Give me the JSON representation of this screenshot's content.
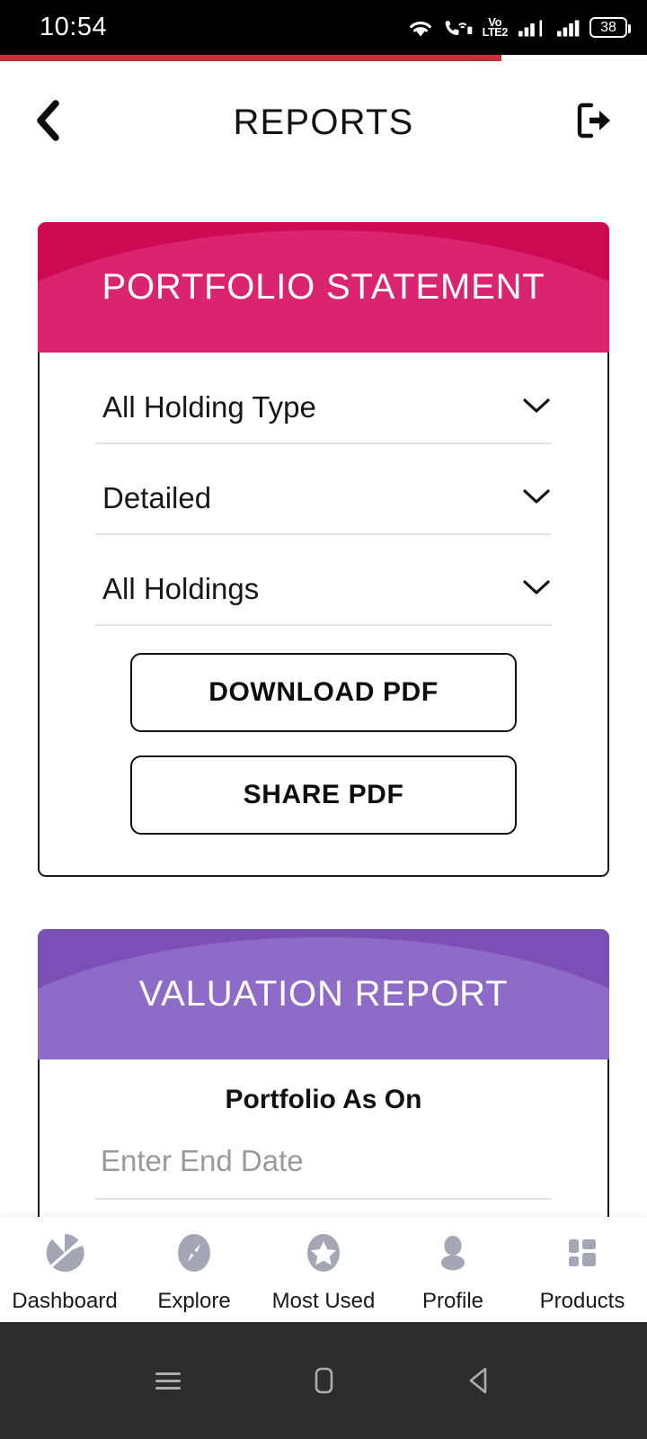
{
  "status_bar": {
    "time": "10:54",
    "battery_level": "38",
    "volte_top": "Vo",
    "volte_bottom": "LTE2",
    "icons": [
      "wifi-icon",
      "wifi-calling-icon",
      "volte-icon",
      "signal-bars-icon-1",
      "signal-bars-icon-2",
      "battery-icon"
    ]
  },
  "loader": {
    "progress_percent": 77.5,
    "color": "#C9303A"
  },
  "header": {
    "title": "REPORTS",
    "back_icon": "chevron-left-icon",
    "logout_icon": "logout-icon"
  },
  "cards": [
    {
      "id": "portfolio-statement",
      "title": "PORTFOLIO STATEMENT",
      "accent": "#CC0A51",
      "accent_light": "#DB2470",
      "dropdowns": [
        {
          "name": "holding-type",
          "value": "All Holding Type"
        },
        {
          "name": "report-format",
          "value": "Detailed"
        },
        {
          "name": "holdings-scope",
          "value": "All Holdings"
        }
      ],
      "buttons": [
        {
          "name": "download-pdf",
          "label": "DOWNLOAD PDF"
        },
        {
          "name": "share-pdf",
          "label": "SHARE PDF"
        }
      ]
    },
    {
      "id": "valuation-report",
      "title": "VALUATION REPORT",
      "accent": "#7B4FB5",
      "accent_light": "#8D6BC6",
      "date_field": {
        "label": "Portfolio As On",
        "value": "",
        "placeholder": "Enter End Date"
      }
    }
  ],
  "bottom_nav": {
    "items": [
      {
        "label": "Dashboard",
        "icon": "pie-chart-icon"
      },
      {
        "label": "Explore",
        "icon": "compass-icon"
      },
      {
        "label": "Most Used",
        "icon": "star-icon"
      },
      {
        "label": "Profile",
        "icon": "person-icon"
      },
      {
        "label": "Products",
        "icon": "grid-icon"
      }
    ],
    "icon_color": "#A3A7B5"
  },
  "android_nav": {
    "buttons": [
      {
        "name": "recents",
        "icon": "menu-icon"
      },
      {
        "name": "home",
        "icon": "home-square-icon"
      },
      {
        "name": "back",
        "icon": "back-triangle-icon"
      }
    ]
  }
}
